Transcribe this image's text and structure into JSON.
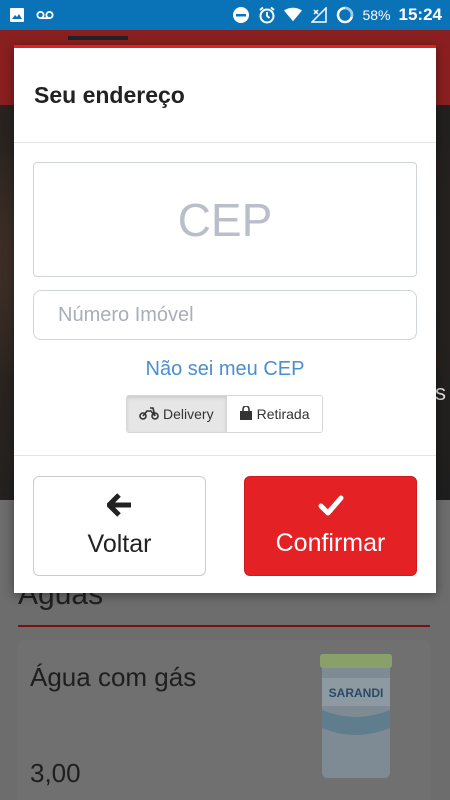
{
  "status_bar": {
    "battery": "58%",
    "time": "15:24",
    "icons": [
      "image-icon",
      "voicemail-icon",
      "dnd-icon",
      "alarm-icon",
      "wifi-icon",
      "signal-icon",
      "battery-icon"
    ]
  },
  "background": {
    "section_title": "Águas",
    "product": {
      "name": "Água com gás",
      "price": "3,00",
      "brand": "SARANDI"
    }
  },
  "modal": {
    "title": "Seu endereço",
    "cep_placeholder": "CEP",
    "number_placeholder": "Número Imóvel",
    "dont_know_link": "Não sei meu CEP",
    "mode_options": [
      {
        "label": "Delivery",
        "icon": "motorcycle-icon",
        "selected": true
      },
      {
        "label": "Retirada",
        "icon": "shopping-bag-icon",
        "selected": false
      }
    ],
    "back_label": "Voltar",
    "confirm_label": "Confirmar"
  },
  "colors": {
    "status_bar": "#0a73b8",
    "confirm": "#e42124",
    "link": "#4a8fd0",
    "accent_border": "#dd2222"
  }
}
